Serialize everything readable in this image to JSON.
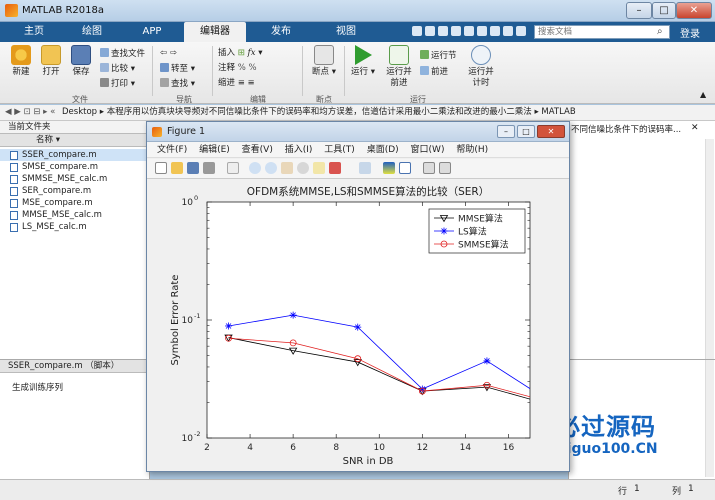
{
  "window": {
    "title": "MATLAB R2018a"
  },
  "tabs": [
    "主页",
    "绘图",
    "APP",
    "编辑器",
    "发布",
    "视图"
  ],
  "search": {
    "placeholder": "搜索文档"
  },
  "login_label": "登录",
  "ribbon": {
    "big": [
      "新建",
      "打开",
      "保存",
      "断点",
      "运行",
      "运行并\n前进",
      "前进",
      "运行并\n计时"
    ],
    "small": {
      "find_files": "查找文件",
      "compare": "比较",
      "print": "打印",
      "goto": "转至",
      "find": "查找",
      "insert": "插入",
      "comment": "注释",
      "indent": "缩进",
      "run_section": "运行节"
    },
    "groups": [
      "文件",
      "导航",
      "编辑",
      "断点",
      "运行"
    ]
  },
  "pathbar": {
    "parts": [
      "Desktop",
      "本程序用以仿真块块导频对不同信噪比条件下的误码率和均方误差，信道估计采用最小二乘法和改进的最小二乘法",
      "MATLAB"
    ]
  },
  "current_folder": {
    "title": "当前文件夹",
    "column": "名称",
    "files": [
      "SSER_compare.m",
      "SMSE_compare.m",
      "SMMSE_MSE_calc.m",
      "SER_compare.m",
      "MSE_compare.m",
      "MMSE_MSE_calc.m",
      "LS_MSE_calc.m"
    ],
    "selected": 0
  },
  "details": {
    "title": "SSER_compare.m （脚本）",
    "desc": "生成训练序列"
  },
  "right_panel": {
    "title": "不同信噪比条件下的误码率..."
  },
  "statusbar": {
    "row_label": "行",
    "row": "1",
    "col_label": "列",
    "col": "1"
  },
  "figure": {
    "title": "Figure 1",
    "menu": [
      "文件(F)",
      "编辑(E)",
      "查看(V)",
      "插入(I)",
      "工具(T)",
      "桌面(D)",
      "窗口(W)",
      "帮助(H)"
    ]
  },
  "logo": {
    "text_cn": "必过源码",
    "text_url": "Biguo100.CN"
  },
  "chart_data": {
    "type": "line",
    "title": "OFDM系统MMSE,LS和SMMSE算法的比较（SER）",
    "xlabel": "SNR in DB",
    "ylabel": "Symbol Error Rate",
    "xlim": [
      2,
      17
    ],
    "ylim": [
      0.01,
      1
    ],
    "yscale": "log",
    "xticks": [
      2,
      4,
      6,
      8,
      10,
      12,
      14,
      16
    ],
    "yticks": [
      {
        "v": 1,
        "label": "10",
        "exp": "0"
      },
      {
        "v": 0.1,
        "label": "10",
        "exp": "-1"
      },
      {
        "v": 0.01,
        "label": "10",
        "exp": "-2"
      }
    ],
    "legend_position": "top-right",
    "x": [
      3,
      6,
      9,
      12,
      15,
      18
    ],
    "series": [
      {
        "name": "MMSE算法",
        "marker": "triangle-down",
        "color": "#000000",
        "values": [
          0.071,
          0.055,
          0.044,
          0.025,
          0.027,
          0.019
        ]
      },
      {
        "name": "LS算法",
        "marker": "star",
        "color": "#0000ff",
        "values": [
          0.089,
          0.11,
          0.087,
          0.026,
          0.045,
          0.02
        ]
      },
      {
        "name": "SMMSE算法",
        "marker": "circle",
        "color": "#e02020",
        "values": [
          0.07,
          0.064,
          0.047,
          0.025,
          0.028,
          0.02
        ]
      }
    ]
  }
}
